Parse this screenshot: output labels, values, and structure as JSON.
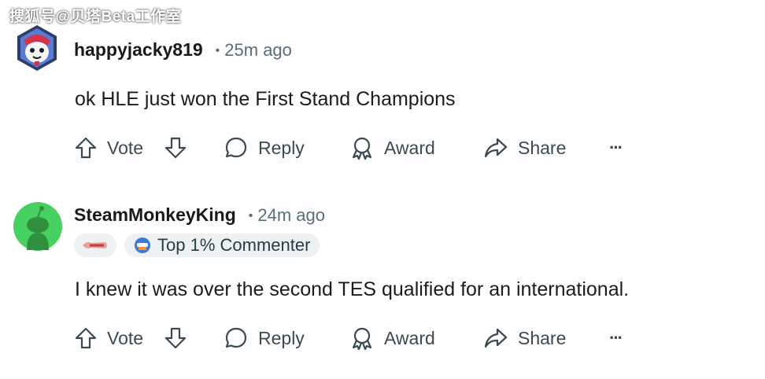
{
  "watermark": "搜狐号@贝塔Beta工作室",
  "comments": [
    {
      "username": "happyjacky819",
      "separator": "•",
      "time": "25m ago",
      "text": "ok HLE just won the First Stand Champions",
      "actions": {
        "vote": "Vote",
        "reply": "Reply",
        "award": "Award",
        "share": "Share",
        "more": "···"
      }
    },
    {
      "username": "SteamMonkeyKing",
      "separator": "•",
      "time": "24m ago",
      "badge": "Top 1% Commenter",
      "text": "I knew it was over the second TES qualified for an international.",
      "actions": {
        "vote": "Vote",
        "reply": "Reply",
        "award": "Award",
        "share": "Share",
        "more": "···"
      }
    }
  ],
  "colors": {
    "muted": "#576f76",
    "badge_bg": "#eef1f3",
    "avatar_green": "#46d160"
  }
}
